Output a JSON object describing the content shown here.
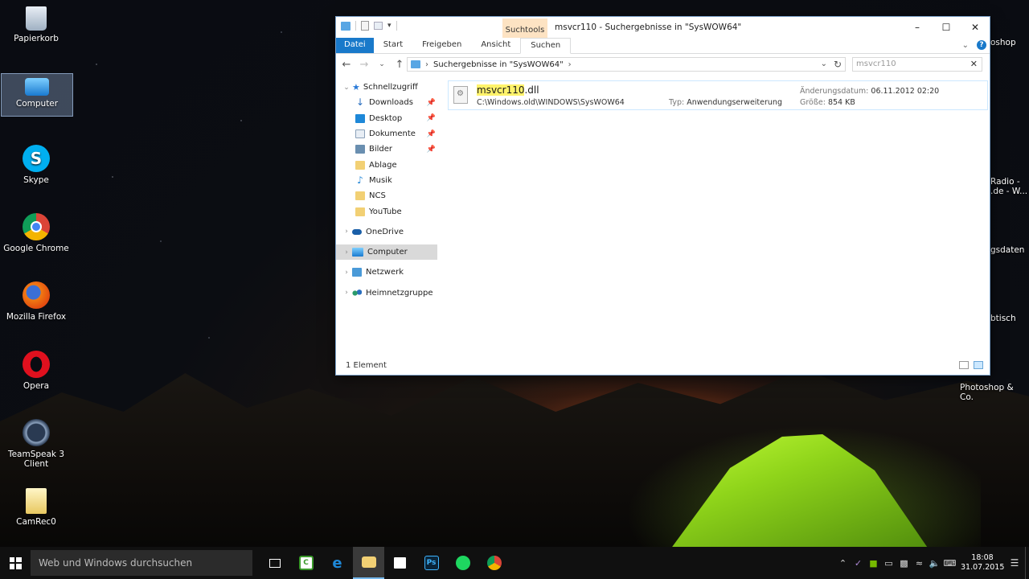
{
  "desktop": {
    "icons": [
      {
        "label": "Papierkorb"
      },
      {
        "label": "Computer"
      },
      {
        "label": "Skype"
      },
      {
        "label": "Google Chrome"
      },
      {
        "label": "Mozilla Firefox"
      },
      {
        "label": "Opera"
      },
      {
        "label": "TeamSpeak 3 Client"
      },
      {
        "label": "CamRec0"
      }
    ],
    "right_labels": [
      {
        "label": "oshop"
      },
      {
        "label": "Radio -"
      },
      {
        "label": ".de - W..."
      },
      {
        "label": "gsdaten"
      },
      {
        "label": "btisch"
      },
      {
        "label": "Photoshop & Co."
      }
    ]
  },
  "window": {
    "title": "msvcr110 - Suchergebnisse in \"SysWOW64\"",
    "context_tab": "Suchtools",
    "ribbon_tabs": [
      "Datei",
      "Start",
      "Freigeben",
      "Ansicht",
      "Suchen"
    ],
    "address": {
      "path": "Suchergebnisse in \"SysWOW64\""
    },
    "search": {
      "value": "msvcr110"
    },
    "nav": {
      "quick_access": "Schnellzugriff",
      "quick_items": [
        {
          "label": "Downloads",
          "pinned": true,
          "color": "#2a6fbf"
        },
        {
          "label": "Desktop",
          "pinned": true,
          "color": "#1e88d8"
        },
        {
          "label": "Dokumente",
          "pinned": true,
          "color": "#8aa0b8"
        },
        {
          "label": "Bilder",
          "pinned": true,
          "color": "#6a8fb0"
        },
        {
          "label": "Ablage",
          "pinned": false,
          "color": "#f2d074"
        },
        {
          "label": "Musik",
          "pinned": false,
          "color": "#2a8ad8"
        },
        {
          "label": "NCS",
          "pinned": false,
          "color": "#f2d074"
        },
        {
          "label": "YouTube",
          "pinned": false,
          "color": "#f2d074"
        }
      ],
      "onedrive": "OneDrive",
      "computer": "Computer",
      "network": "Netzwerk",
      "homegroup": "Heimnetzgruppe"
    },
    "result": {
      "name_highlight": "msvcr110",
      "name_rest": ".dll",
      "path": "C:\\Windows.old\\WINDOWS\\SysWOW64",
      "type_label": "Typ:",
      "type_value": "Anwendungserweiterung",
      "date_label": "Änderungsdatum:",
      "date_value": "06.11.2012 02:20",
      "size_label": "Größe:",
      "size_value": "854 KB"
    },
    "status": "1 Element"
  },
  "taskbar": {
    "search_placeholder": "Web und Windows durchsuchen",
    "time": "18:08",
    "date": "31.07.2015"
  }
}
